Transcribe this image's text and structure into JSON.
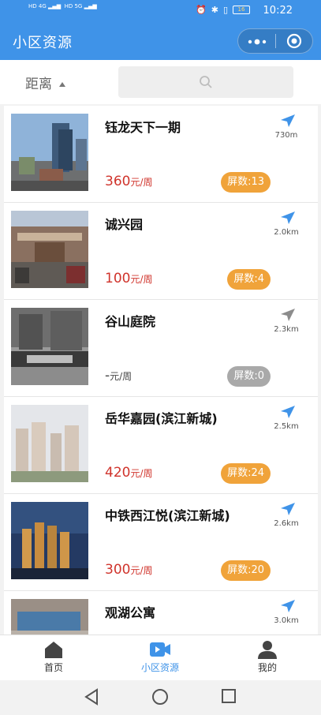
{
  "status_bar": {
    "network_left": "HD 4G",
    "network_right": "HD 5G",
    "battery": "16",
    "time": "10:22"
  },
  "header": {
    "title": "小区资源",
    "more_label": "•·•"
  },
  "filter": {
    "sort_label": "距离",
    "search_placeholder": ""
  },
  "colors": {
    "primary": "#3f93e8",
    "price": "#d0342c",
    "badge": "#f0a33a",
    "badge_inactive": "#a9a9a9"
  },
  "listings": [
    {
      "name": "钰龙天下一期",
      "price": "360",
      "unit": "元/周",
      "screens": "屏数:13",
      "distance": "730m",
      "active": true
    },
    {
      "name": "诚兴园",
      "price": "100",
      "unit": "元/周",
      "screens": "屏数:4",
      "distance": "2.0km",
      "active": true
    },
    {
      "name": "谷山庭院",
      "price": "-",
      "unit": "元/周",
      "screens": "屏数:0",
      "distance": "2.3km",
      "active": false
    },
    {
      "name": "岳华嘉园(滨江新城)",
      "price": "420",
      "unit": "元/周",
      "screens": "屏数:24",
      "distance": "2.5km",
      "active": true
    },
    {
      "name": "中铁西江悦(滨江新城)",
      "price": "300",
      "unit": "元/周",
      "screens": "屏数:20",
      "distance": "2.6km",
      "active": true
    },
    {
      "name": "观湖公寓",
      "price": "",
      "unit": "",
      "screens": "",
      "distance": "3.0km",
      "active": true
    }
  ],
  "tabbar": {
    "home": "首页",
    "resources": "小区资源",
    "mine": "我的"
  },
  "icons": {
    "search": "search-icon",
    "navigate": "navigate-arrow-icon",
    "home": "home-icon",
    "video": "video-icon",
    "user": "user-icon"
  }
}
